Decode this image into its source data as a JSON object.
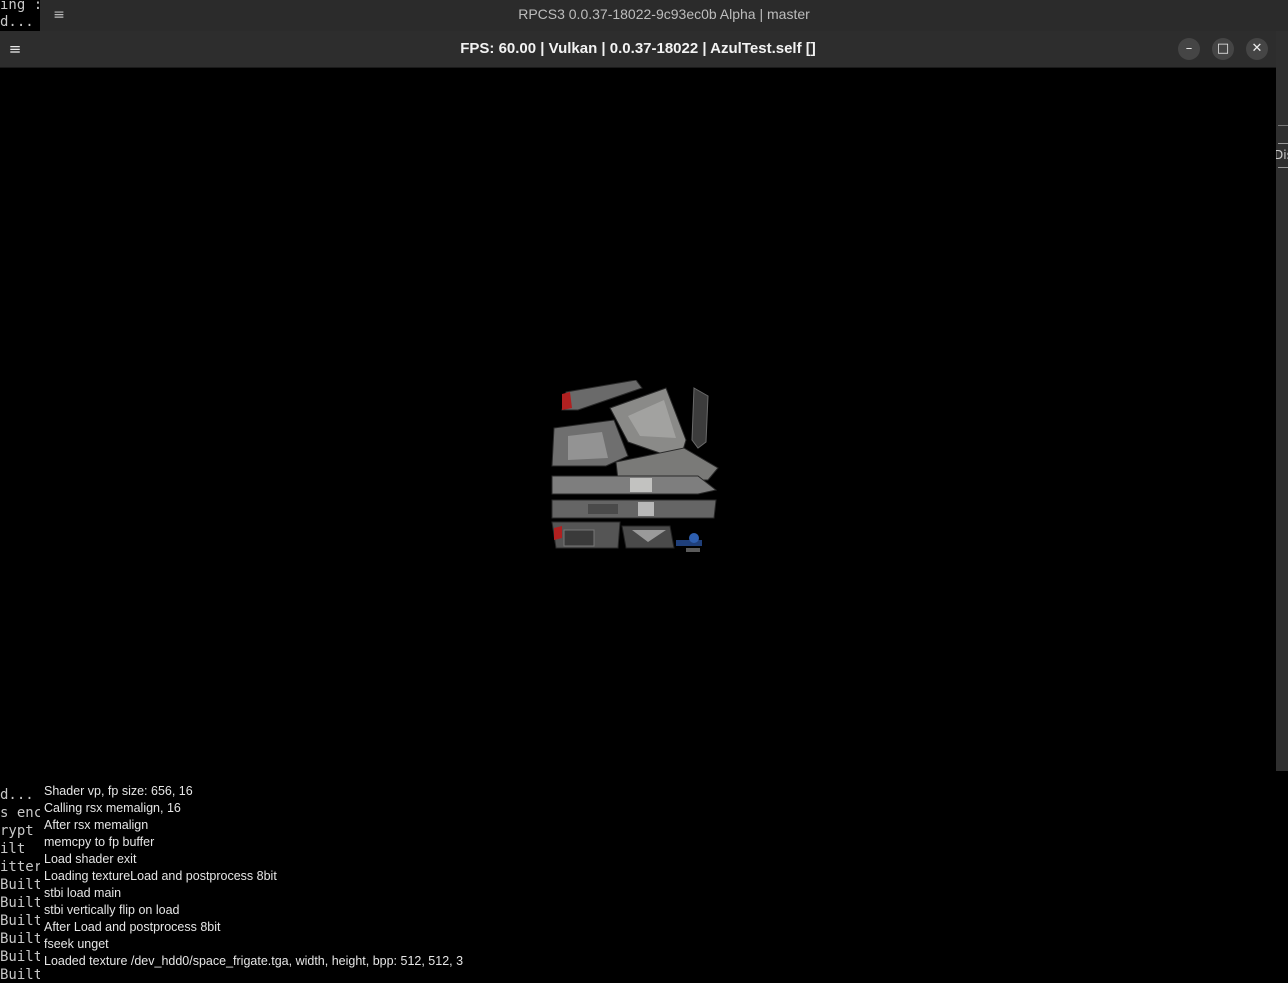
{
  "terminal": {
    "lines_top": [
      "ing :",
      "d..."
    ],
    "lines_bottom": [
      "d...",
      "s enc",
      "rypt",
      "ilt",
      "itter",
      "Built",
      "Built",
      "Built",
      "Built",
      "Built",
      "Built"
    ]
  },
  "main_window": {
    "title": "RPCS3 0.0.37-18022-9c93ec0b Alpha | master",
    "menu_icon": "≡",
    "right_edge_text": "Dis"
  },
  "game_window": {
    "title": "FPS: 60.00 | Vulkan | 0.0.37-18022 | AzulTest.self []",
    "menu_icon": "≡",
    "minimize_glyph": "–",
    "maximize_glyph": "□",
    "close_glyph": "✕",
    "icons": {
      "menu": "hamburger-menu-icon",
      "minimize": "minimize-icon",
      "maximize": "maximize-icon",
      "close": "close-icon"
    },
    "scene": {
      "object": "space-frigate-texture"
    }
  },
  "console": {
    "lines": [
      "Shader vp, fp size: 656, 16",
      "Calling rsx memalign, 16",
      "After rsx memalign",
      "memcpy to fp buffer",
      "Load shader exit",
      "Loading textureLoad and postprocess 8bit",
      "stbi load main",
      "stbi vertically flip on load",
      "After Load and postprocess 8bit",
      "fseek unget",
      "Loaded texture /dev_hdd0/space_frigate.tga, width, height, bpp: 512, 512, 3"
    ]
  }
}
